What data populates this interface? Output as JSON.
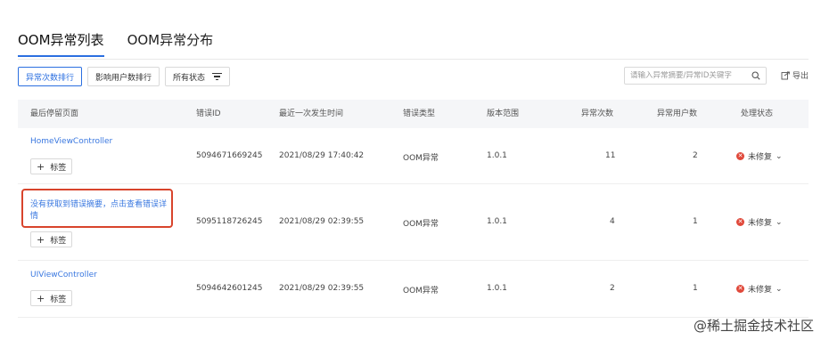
{
  "tabs": [
    {
      "label": "OOM异常列表",
      "active": true
    },
    {
      "label": "OOM异常分布",
      "active": false
    }
  ],
  "toolbar": {
    "sort_by_count": "异常次数排行",
    "sort_by_users": "影响用户数排行",
    "status_filter": "所有状态"
  },
  "search": {
    "placeholder": "请输入异常摘要/异常ID关键字"
  },
  "export_label": "导出",
  "columns": [
    "最后停留页面",
    "错误ID",
    "最近一次发生时间",
    "错误类型",
    "版本范围",
    "异常次数",
    "异常用户数",
    "处理状态"
  ],
  "rows": [
    {
      "page": "HomeViewController",
      "tag_label": "标签",
      "error_id": "5094671669245",
      "time": "2021/08/29 17:40:42",
      "type": "OOM异常",
      "version": "1.0.1",
      "count": "11",
      "users": "2",
      "status": "未修复"
    },
    {
      "page_line1": "没有获取到错误摘要，点击查看错误详",
      "page_line2": "情",
      "tag_label": "标签",
      "error_id": "5095118726245",
      "time": "2021/08/29 02:39:55",
      "type": "OOM异常",
      "version": "1.0.1",
      "count": "4",
      "users": "1",
      "status": "未修复"
    },
    {
      "page": "UIViewController",
      "tag_label": "标签",
      "error_id": "5094642601245",
      "time": "2021/08/29 02:39:55",
      "type": "OOM异常",
      "version": "1.0.1",
      "count": "2",
      "users": "1",
      "status": "未修复"
    }
  ],
  "watermark": "@稀土掘金技术社区",
  "colors": {
    "accent": "#2b6fe0",
    "link": "#3a78e0",
    "highlight": "#d8442c",
    "status_red": "#e0483a"
  }
}
